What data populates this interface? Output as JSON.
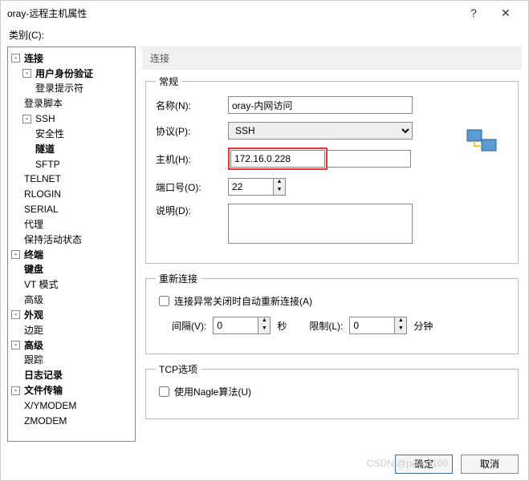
{
  "window": {
    "title": "oray-远程主机属性",
    "help": "?",
    "close": "✕"
  },
  "category_label": "类别(C):",
  "tree": {
    "connection": "连接",
    "user_auth": "用户身份验证",
    "login_prompt": "登录提示符",
    "login_script": "登录脚本",
    "ssh": "SSH",
    "security": "安全性",
    "tunnel": "隧道",
    "sftp": "SFTP",
    "telnet": "TELNET",
    "rlogin": "RLOGIN",
    "serial": "SERIAL",
    "proxy": "代理",
    "keepalive": "保持活动状态",
    "terminal": "终端",
    "keyboard": "键盘",
    "vtmode": "VT 模式",
    "advanced_t": "高级",
    "appearance": "外观",
    "margin": "边距",
    "advanced": "高级",
    "trace": "跟踪",
    "logging": "日志记录",
    "filetransfer": "文件传输",
    "xymodem": "X/YMODEM",
    "zmodem": "ZMODEM"
  },
  "right": {
    "header": "连接",
    "general": {
      "legend": "常规",
      "name_label": "名称(N):",
      "name_value": "oray-内网访问",
      "protocol_label": "协议(P):",
      "protocol_value": "SSH",
      "host_label": "主机(H):",
      "host_value": "172.16.0.228",
      "port_label": "端口号(O):",
      "port_value": "22",
      "desc_label": "说明(D):",
      "desc_value": ""
    },
    "reconnect": {
      "legend": "重新连接",
      "auto_label": "连接异常关闭时自动重新连接(A)",
      "interval_label": "间隔(V):",
      "interval_value": "0",
      "interval_unit": "秒",
      "limit_label": "限制(L):",
      "limit_value": "0",
      "limit_unit": "分钟"
    },
    "tcp": {
      "legend": "TCP选项",
      "nagle_label": "使用Nagle算法(U)"
    }
  },
  "buttons": {
    "ok": "确定",
    "cancel": "取消"
  },
  "watermark": "CSDN @puyu1100"
}
